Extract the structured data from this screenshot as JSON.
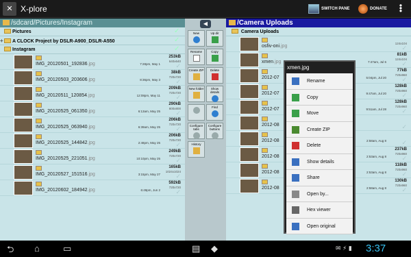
{
  "app": {
    "title": "X-plore"
  },
  "toolbar": {
    "switch_pane": "SWITCH PANE",
    "donate": "DONATE"
  },
  "left_pane": {
    "path": "/sdcard/Pictures/Instagram",
    "folders": [
      {
        "name": "Pictures",
        "expander": ""
      },
      {
        "name": "A CLOCK Project by DSLR-A900_DSLR-A550",
        "expander": "+"
      },
      {
        "name": "Instagram",
        "expander": ""
      }
    ],
    "files": [
      {
        "name": "IMG_20120501_192836",
        "ext": ".jpg",
        "date": "7:28pm, May 1",
        "size": "253kB",
        "dim": "640x640"
      },
      {
        "name": "IMG_20120503_203606",
        "ext": ".jpg",
        "date": "8:36pm, May 3",
        "size": "38kB",
        "dim": "720x720"
      },
      {
        "name": "IMG_20120511_120854",
        "ext": ".jpg",
        "date": "12:08pm, May 11",
        "size": "209kB",
        "dim": "720x720"
      },
      {
        "name": "IMG_20120525_061350",
        "ext": ".jpg",
        "date": "6:13am, May 25",
        "size": "290kB",
        "dim": "800x800"
      },
      {
        "name": "IMG_20120525_063940",
        "ext": ".jpg",
        "date": "6:39am, May 25",
        "size": "206kB",
        "dim": "720x720"
      },
      {
        "name": "IMG_20120525_144842",
        "ext": ".jpg",
        "date": "2:48pm, May 25",
        "size": "206kB",
        "dim": "720x720"
      },
      {
        "name": "IMG_20120525_221051",
        "ext": ".jpg",
        "date": "10:10pm, May 25",
        "size": "249kB",
        "dim": "720x720"
      },
      {
        "name": "IMG_20120527_151516",
        "ext": ".jpg",
        "date": "3:15pm, May 27",
        "size": "165kB",
        "dim": "1024x1024"
      },
      {
        "name": "IMG_20120602_184942",
        "ext": ".jpg",
        "date": "6:49pm, Jun 2",
        "size": "592kB",
        "dim": "720x720"
      }
    ]
  },
  "tools": [
    {
      "label": "New",
      "icon": "info-icon"
    },
    {
      "label": "Up dir",
      "icon": "up-arrow-icon"
    },
    {
      "label": "Rename",
      "icon": "rename-icon"
    },
    {
      "label": "Copy",
      "icon": "copy-icon"
    },
    {
      "label": "Create ZIP",
      "icon": "zip-icon"
    },
    {
      "label": "Delete",
      "icon": "trash-icon"
    },
    {
      "label": "New folder",
      "icon": "new-folder-icon"
    },
    {
      "label": "Show details",
      "icon": "details-icon"
    },
    {
      "label": "",
      "icon": "blank-icon"
    },
    {
      "label": "Find",
      "icon": "find-icon"
    },
    {
      "label": "Configure tabs",
      "icon": "configure-tabs-icon"
    },
    {
      "label": "Configure buttons",
      "icon": "configure-buttons-icon"
    },
    {
      "label": "History",
      "icon": "history-icon"
    }
  ],
  "right_pane": {
    "path": "/Camera Uploads",
    "folder": "Camera Uploads",
    "files": [
      {
        "name": "osfiv-oni",
        "ext": ".jpg",
        "date": "",
        "size": "",
        "dim": "124x104"
      },
      {
        "name": "xmen",
        "ext": ".jpg",
        "date": "7:47am, Jul 6",
        "size": "81kB",
        "dim": "124x104"
      },
      {
        "name": "2012-07",
        "ext": "",
        "date": "5:04pm, Jul 20",
        "size": "77kB",
        "dim": "720x960"
      },
      {
        "name": "2012-07",
        "ext": "",
        "date": "9:47am, Jul 20",
        "size": "128kB",
        "dim": "720x960"
      },
      {
        "name": "2012-07",
        "ext": "",
        "date": "9:51am, Jul 28",
        "size": "128kB",
        "dim": "720x960"
      },
      {
        "name": "2012-08",
        "ext": "",
        "date": "",
        "size": "",
        "dim": ""
      },
      {
        "name": "2012-08",
        "ext": "",
        "date": "2:58am, Aug 8",
        "size": "",
        "dim": ""
      },
      {
        "name": "2012-08",
        "ext": "",
        "date": "2:53am, Aug 8",
        "size": "237kB",
        "dim": "720x960"
      },
      {
        "name": "2012-08",
        "ext": "",
        "date": "2:53am, Aug 8",
        "size": "118kB",
        "dim": "720x960"
      },
      {
        "name": "2012-08",
        "ext": "",
        "date": "2:58am, Aug 8",
        "size": "130kB",
        "dim": "720x960"
      }
    ]
  },
  "context_menu": {
    "title": "xmen.jpg",
    "items": [
      {
        "label": "Rename",
        "icon": "rename-icon"
      },
      {
        "label": "Copy",
        "icon": "copy-icon"
      },
      {
        "label": "Move",
        "icon": "move-icon"
      },
      {
        "label": "Create ZIP",
        "icon": "zip-icon"
      },
      {
        "label": "Delete",
        "icon": "trash-icon"
      },
      {
        "label": "Show details",
        "icon": "details-icon"
      },
      {
        "label": "Share",
        "icon": "share-icon"
      },
      {
        "label": "Open by...",
        "icon": "open-by-icon"
      },
      {
        "label": "Hex viewer",
        "icon": "hex-icon"
      },
      {
        "label": "Open original",
        "icon": "open-original-icon"
      }
    ]
  },
  "navbar": {
    "clock": "3:37"
  },
  "colors": {
    "pane_bg": "#c9e4e8",
    "right_path": "#1a1aa0",
    "clock": "#38c0f0"
  }
}
